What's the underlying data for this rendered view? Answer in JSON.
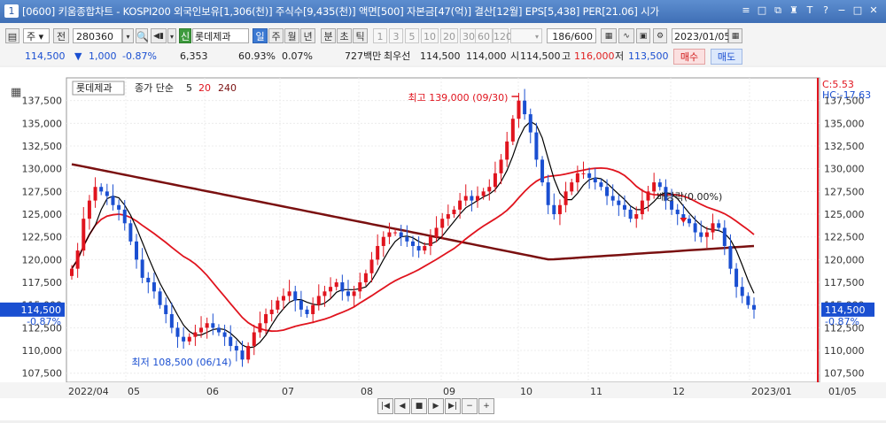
{
  "window": {
    "number": "1",
    "title": "[0600] 키움종합차트 - KOSPI200 외국인보유[1,306(천)] 주식수[9,435(천)] 액면[500] 자본금[47(억)] 결산[12월] EPS[5,438] PER[21.06] 시가",
    "controls": [
      "≡",
      "□",
      "⧉",
      "♜",
      "T",
      "?",
      "−",
      "□",
      "✕"
    ]
  },
  "toolbar": {
    "market_select": "주",
    "prev_btn": "전",
    "stock_code": "280360",
    "stock_name": "롯데제과",
    "stock_badge": "신",
    "period_buttons": [
      "일",
      "주",
      "월",
      "년",
      "분",
      "초",
      "틱"
    ],
    "active_period": "일",
    "interval_buttons": [
      "1",
      "3",
      "5",
      "10",
      "20",
      "30",
      "60",
      "120"
    ],
    "count": "186",
    "count_total": "/600",
    "date": "2023/01/05"
  },
  "quote": {
    "price": "114,500",
    "change": "1,000",
    "change_pct": "-0.87%",
    "volume": "6,353",
    "volume_ratio": "60.93%",
    "turnover": "0.07%",
    "amount": "727백만",
    "best_ask_label": "최우선",
    "best_ask": "114,500",
    "best_bid": "114,000",
    "open_label": "시",
    "open": "114,500",
    "high_label": "고",
    "high": "116,000",
    "low_label": "저",
    "low": "113,500",
    "buy_label": "매수",
    "sell_label": "매도"
  },
  "chart_overlay": {
    "stock_tag": "롯데제과",
    "indicator_label": "종가 단순",
    "ma_periods": [
      "5",
      "20",
      "240"
    ],
    "ma_colors": [
      "#000000",
      "#e0141e",
      "#7a1010"
    ],
    "right_top_c": "C:5.53",
    "right_top_hc": "HC:-17.63",
    "price_label": "114,500",
    "price_pct": "-0.87%",
    "high_annotation": "최고 139,000 (09/30)",
    "low_annotation": "최저 108,500 (06/14)",
    "dividend_annotation": "배당락(0.00%)"
  },
  "colors": {
    "up": "#e0141e",
    "down": "#1a4fd1",
    "ma5": "#000000",
    "ma20": "#e0141e",
    "ma240": "#7a1010"
  },
  "chart_data": {
    "type": "candlestick",
    "y_ticks": [
      "137,500",
      "135,000",
      "132,500",
      "130,000",
      "127,500",
      "125,000",
      "122,500",
      "120,000",
      "117,500",
      "115,000",
      "112,500",
      "110,000",
      "107,500"
    ],
    "ylim": [
      106500,
      140000
    ],
    "x_labels": [
      "2022/04",
      "05",
      "06",
      "07",
      "08",
      "09",
      "10",
      "11",
      "12",
      "2023/01",
      "01/05"
    ],
    "x_months": [
      "2022-04",
      "2022-05",
      "2022-06",
      "2022-07",
      "2022-08",
      "2022-09",
      "2022-10",
      "2022-11",
      "2022-12",
      "2023-01",
      "2023-01-05"
    ],
    "close_series_approx": [
      119000,
      121000,
      124500,
      126500,
      128000,
      127500,
      127000,
      126000,
      125500,
      124000,
      122000,
      120000,
      118000,
      117500,
      116500,
      115000,
      114000,
      112500,
      111500,
      111000,
      111500,
      112000,
      112500,
      113000,
      112500,
      112000,
      111500,
      110500,
      110000,
      109000,
      110500,
      112000,
      113000,
      114000,
      114500,
      115500,
      116000,
      116500,
      115500,
      114500,
      114000,
      115000,
      116000,
      116500,
      117000,
      117500,
      116500,
      116000,
      116500,
      117500,
      118500,
      120000,
      121500,
      122500,
      123000,
      123000,
      122500,
      122000,
      121500,
      121000,
      121500,
      122500,
      123500,
      124500,
      125000,
      125500,
      126500,
      127000,
      126500,
      127000,
      127500,
      128000,
      129500,
      131000,
      133000,
      135500,
      137500,
      136000,
      134000,
      131000,
      128500,
      126000,
      125000,
      126000,
      127500,
      128500,
      129500,
      129500,
      129000,
      128500,
      128000,
      127000,
      126500,
      126000,
      125500,
      124500,
      125000,
      126500,
      127500,
      128500,
      128000,
      126500,
      125500,
      125000,
      124500,
      124000,
      123000,
      122500,
      123000,
      124000,
      123500,
      121500,
      119000,
      117000,
      116000,
      115000,
      114500
    ],
    "ma240_start": 130500,
    "ma240_min": 120000,
    "ma240_end": 121500
  }
}
